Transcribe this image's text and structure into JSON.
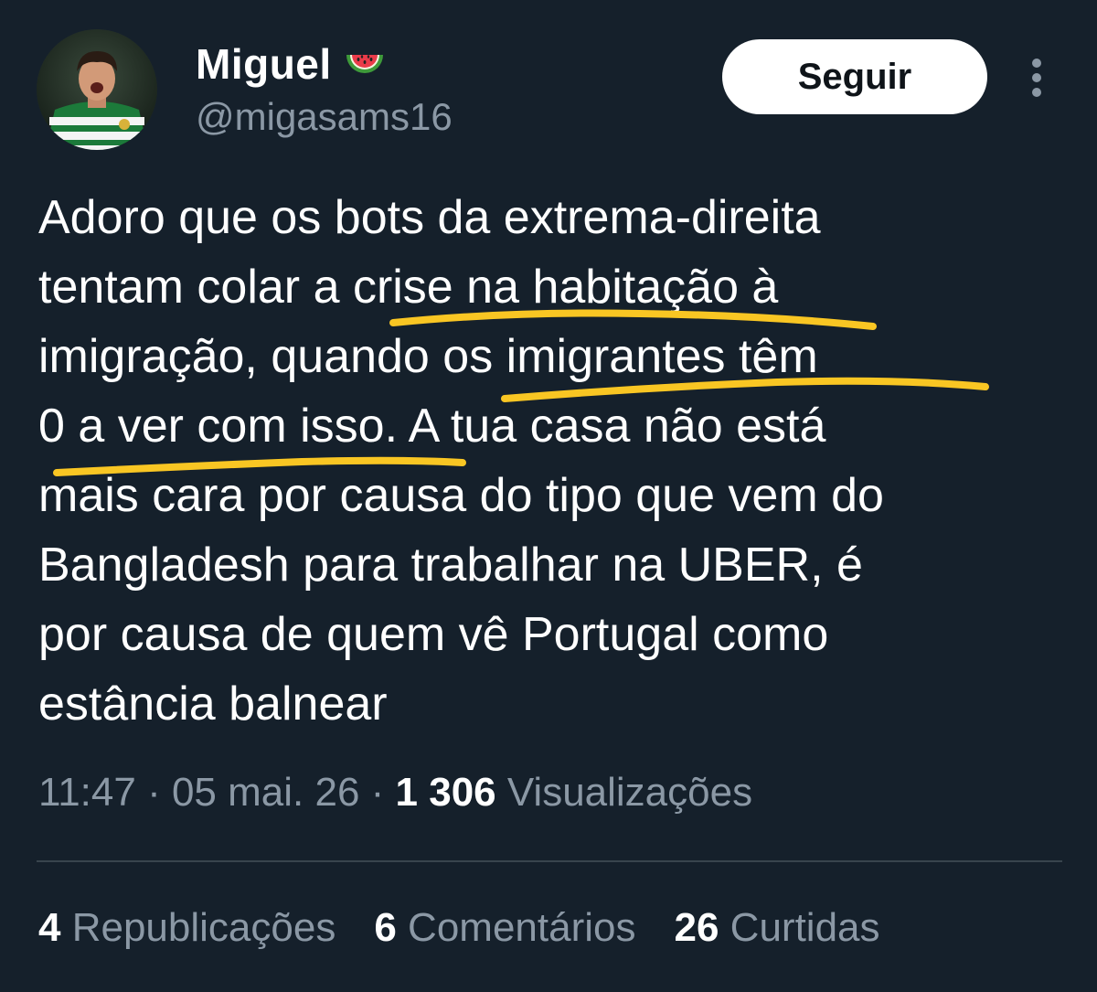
{
  "author": {
    "display_name": "Miguel",
    "emoji_icon": "watermelon-icon",
    "handle": "@migasams16"
  },
  "follow_button": {
    "label": "Seguir"
  },
  "more_menu_icon": "more-vertical-icon",
  "tweet": {
    "lines": [
      "Adoro que os bots da extrema-direita",
      "tentam colar a crise na habitação à",
      "imigração, quando os imigrantes têm",
      "0 a ver com isso. A tua casa não está",
      "mais cara por causa do tipo que vem do",
      "Bangladesh para trabalhar na UBER, é",
      "por causa de quem vê Portugal como",
      "estância balnear"
    ],
    "highlight_color": "#f9c623"
  },
  "meta": {
    "time": "11:47",
    "sep1": " · ",
    "date": "05 mai. 26",
    "sep2": " · ",
    "views_count": "1 306",
    "views_label": " Visualizações"
  },
  "stats": {
    "reposts": {
      "count": "4",
      "label": " Repub­licações"
    },
    "comments": {
      "count": "6",
      "label": " Comentários"
    },
    "likes": {
      "count": "26",
      "label": " Curtidas"
    }
  },
  "colors": {
    "background": "#15202b",
    "text": "#ffffff",
    "secondary": "#8b98a5",
    "divider": "#38444d"
  }
}
